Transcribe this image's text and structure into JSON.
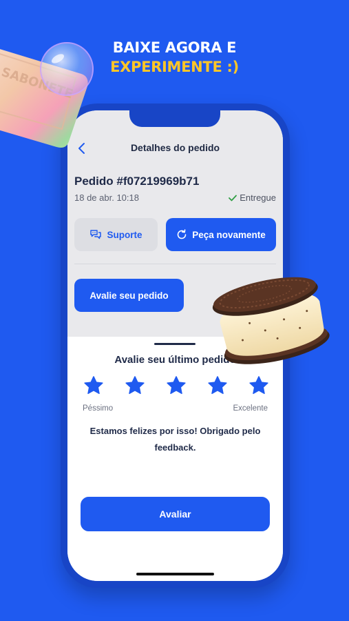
{
  "promo": {
    "line1": "BAIXE AGORA E",
    "line2": "EXPERIMENTE :)"
  },
  "header": {
    "title": "Detalhes do pedido",
    "back_icon": "chevron-left-icon"
  },
  "order": {
    "id": "Pedido #f07219969b71",
    "date": "18 de abr. 10:18",
    "status": "Entregue",
    "status_icon": "check-icon"
  },
  "actions": {
    "support_label": "Suporte",
    "support_icon": "chat-bubbles-icon",
    "reorder_label": "Peça novamente",
    "reorder_icon": "refresh-icon",
    "rate_order_label": "Avalie seu pedido"
  },
  "rating_sheet": {
    "title": "Avalie seu último pedido",
    "stars_selected": 5,
    "stars_total": 5,
    "scale_low": "Péssimo",
    "scale_high": "Excelente",
    "feedback_message": "Estamos felizes por isso! Obrigado pelo feedback.",
    "submit_label": "Avaliar"
  },
  "colors": {
    "brand_blue": "#1f5af0",
    "headline_yellow": "#ffc627",
    "text_dark": "#1f2a48",
    "success_green": "#2f9e44"
  },
  "decor": {
    "soap_text": "SABONETE"
  }
}
